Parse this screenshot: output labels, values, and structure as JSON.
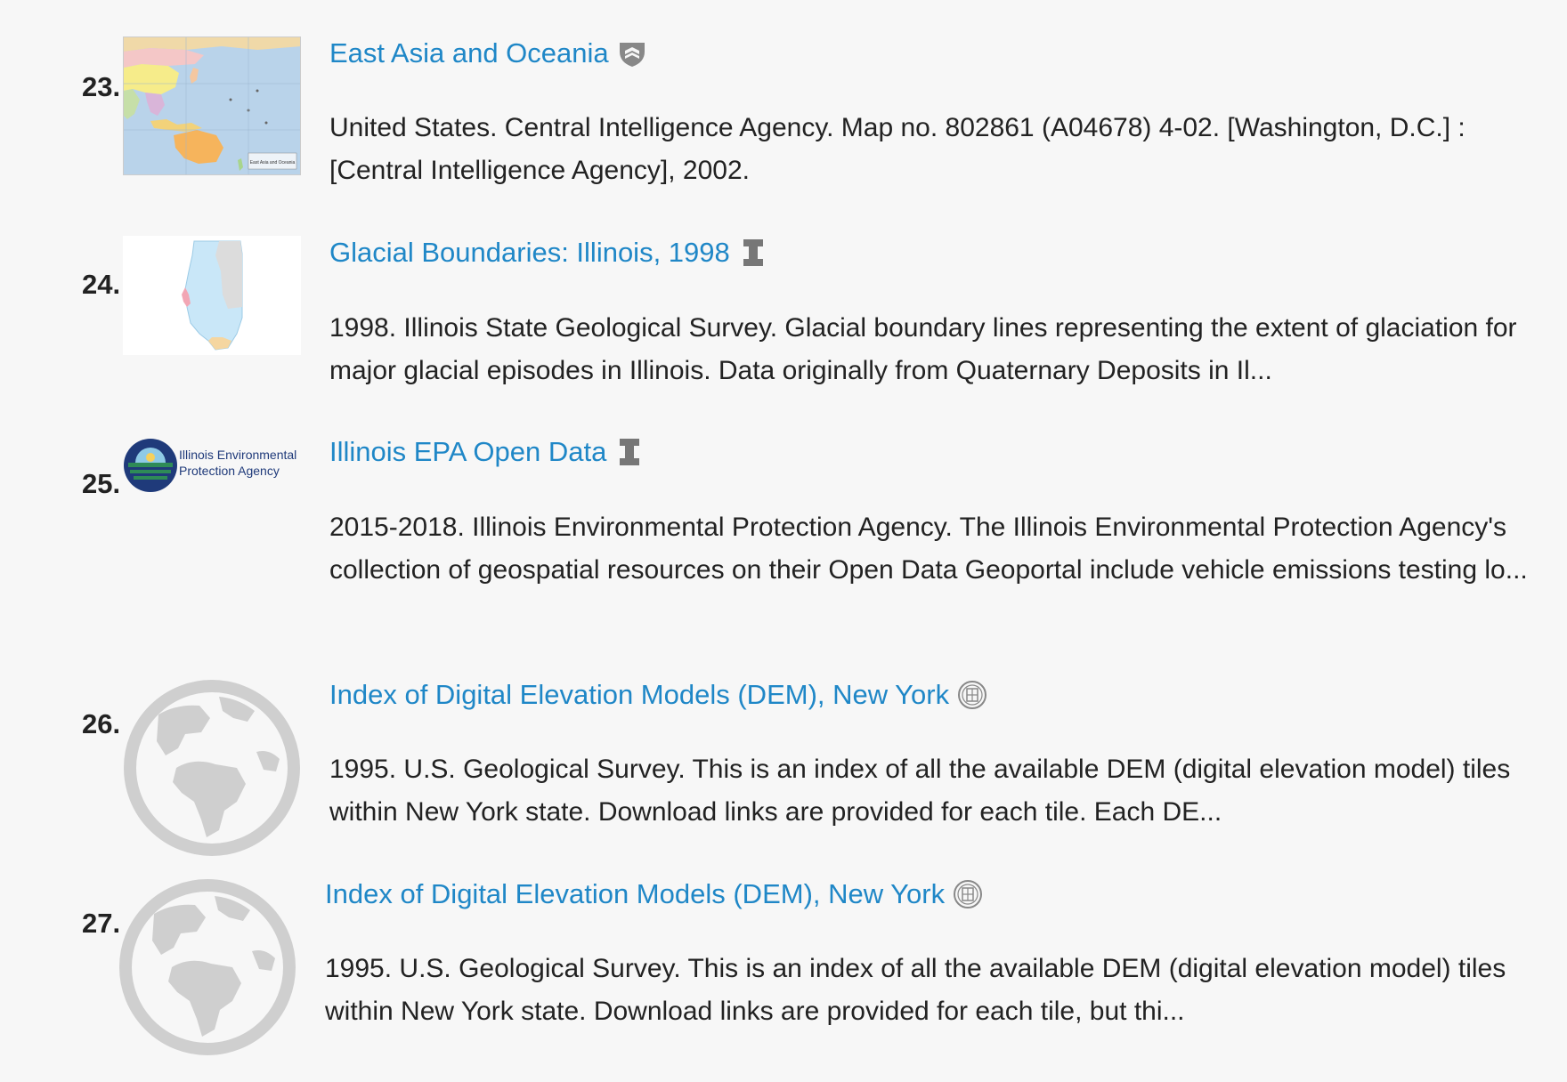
{
  "results": [
    {
      "number": "23.",
      "title": "East Asia and Oceania",
      "institution_icon": "princeton-shield-icon",
      "thumbnail": "east-asia-map-thumbnail",
      "description": "United States. Central Intelligence Agency. Map no. 802861 (A04678) 4-02. [Washington, D.C.] : [Central Intelligence Agency], 2002.",
      "map_caption": "East Asia and Oceania"
    },
    {
      "number": "24.",
      "title": "Glacial Boundaries: Illinois, 1998",
      "institution_icon": "illinois-block-i-icon",
      "thumbnail": "illinois-glacial-map-thumbnail",
      "description": "1998. Illinois State Geological Survey. Glacial boundary lines representing the extent of glaciation for major glacial episodes in Illinois. Data originally from Quaternary Deposits in Il..."
    },
    {
      "number": "25.",
      "title": "Illinois EPA Open Data",
      "institution_icon": "illinois-block-i-icon",
      "thumbnail": "illinois-epa-logo",
      "logo_text_line1": "Illinois Environmental",
      "logo_text_line2": "Protection Agency",
      "description": "2015-2018. Illinois Environmental Protection Agency. The Illinois Environmental Protection Agency's collection of geospatial resources on their Open Data Geoportal include vehicle emissions testing lo..."
    },
    {
      "number": "26.",
      "title": "Index of Digital Elevation Models (DEM), New York",
      "institution_icon": "cornell-seal-icon",
      "thumbnail": "globe-placeholder-icon",
      "description": "1995. U.S. Geological Survey. This is an index of all the available DEM (digital elevation model) tiles within New York state. Download links are provided for each tile. Each DE..."
    },
    {
      "number": "27.",
      "title": "Index of Digital Elevation Models (DEM), New York",
      "institution_icon": "cornell-seal-icon",
      "thumbnail": "globe-placeholder-icon",
      "description": "1995. U.S. Geological Survey. This is an index of all the available DEM (digital elevation model) tiles within New York state. Download links are provided for each tile, but thi..."
    }
  ],
  "colors": {
    "link": "#1f87c7",
    "text": "#222222",
    "background": "#f7f7f7",
    "placeholder_globe": "#cfcfcf",
    "epa_navy": "#1f3a7a"
  }
}
